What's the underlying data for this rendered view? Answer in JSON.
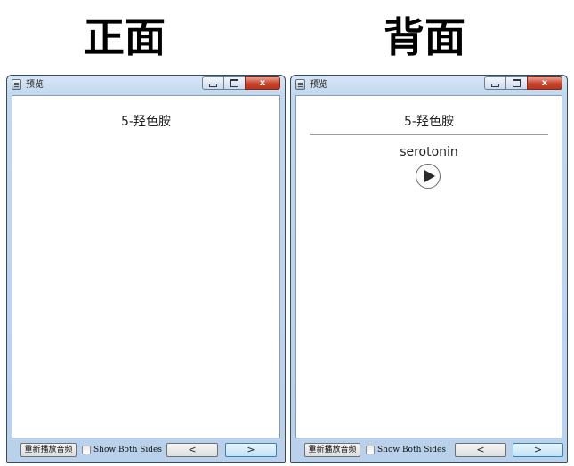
{
  "headings": {
    "front": "正面",
    "back": "背面"
  },
  "windows": {
    "front": {
      "title": "预览",
      "card_front_text": "5-羟色胺",
      "replay_label": "重新播放音频",
      "show_both_label": "Show Both Sides",
      "prev_label": "<",
      "next_label": ">"
    },
    "back": {
      "title": "预览",
      "card_front_text": "5-羟色胺",
      "card_back_text": "serotonin",
      "replay_label": "重新播放音频",
      "show_both_label": "Show Both Sides",
      "prev_label": "<",
      "next_label": ">"
    }
  },
  "caption_buttons": {
    "close_glyph": "x"
  },
  "icons": {
    "app": "preview-app-icon",
    "minimize": "minimize-icon",
    "maximize": "maximize-icon",
    "close": "close-icon",
    "play": "play-icon"
  },
  "colors": {
    "close_button": "#c7432a",
    "window_frame": "#b9d1ea",
    "next_button_border": "#3c7fb1"
  }
}
